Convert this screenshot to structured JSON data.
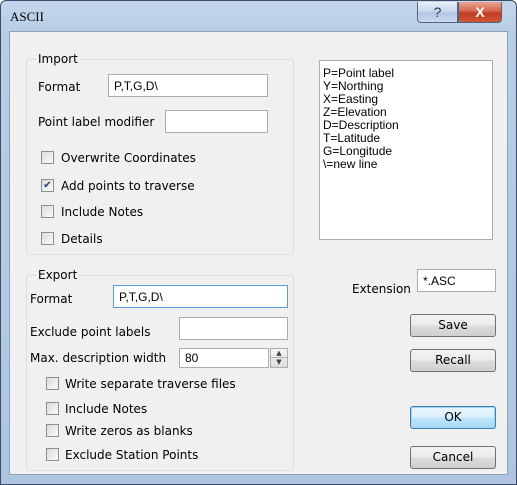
{
  "window": {
    "title": "ASCII",
    "help_glyph": "?",
    "close_glyph": "X"
  },
  "import": {
    "group_label": "Import",
    "format_label": "Format",
    "format_value": "P,T,G,D\\",
    "point_label_modifier_label": "Point label modifier",
    "point_label_modifier_value": "",
    "options": [
      {
        "label": "Overwrite Coordinates",
        "checked": false
      },
      {
        "label": "Add points to traverse",
        "checked": true
      },
      {
        "label": "Include Notes",
        "checked": false
      },
      {
        "label": "Details",
        "checked": false
      }
    ]
  },
  "legend": {
    "lines": [
      "P=Point label",
      "Y=Northing",
      "X=Easting",
      "Z=Elevation",
      "D=Description",
      "T=Latitude",
      "G=Longitude",
      "\\=new line"
    ]
  },
  "export": {
    "group_label": "Export",
    "format_label": "Format",
    "format_value": "P,T,G,D\\",
    "exclude_point_labels_label": "Exclude point labels",
    "exclude_point_labels_value": "",
    "max_description_width_label": "Max. description width",
    "max_description_width_value": "80",
    "options": [
      {
        "label": "Write separate traverse files",
        "checked": false
      },
      {
        "label": "Include Notes",
        "checked": false
      },
      {
        "label": "Write zeros as blanks",
        "checked": false
      },
      {
        "label": "Exclude Station Points",
        "checked": false
      }
    ]
  },
  "extension": {
    "label": "Extension",
    "value": "*.ASC"
  },
  "buttons": {
    "save": "Save",
    "recall": "Recall",
    "ok": "OK",
    "cancel": "Cancel"
  }
}
